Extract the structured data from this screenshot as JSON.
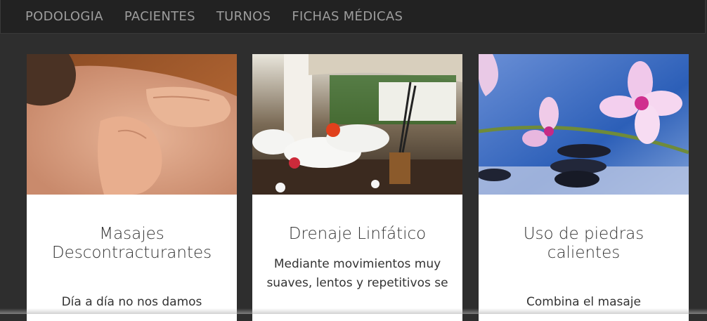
{
  "navbar": {
    "items": [
      {
        "label": "PODOLOGIA"
      },
      {
        "label": "PACIENTES"
      },
      {
        "label": "TURNOS"
      },
      {
        "label": "FICHAS MÉDICAS"
      }
    ],
    "background": "#222222",
    "link_color": "#9d9d9d"
  },
  "cards": [
    {
      "title": "Masajes Descontracturantes",
      "text": "Día a día no nos damos",
      "image": "back-massage-photo"
    },
    {
      "title": "Drenaje Linfático",
      "text": "Mediante movimientos muy suaves, lentos y repetitivos se",
      "image": "spa-towels-incense-photo"
    },
    {
      "title": "Uso de piedras calientes",
      "text": "Combina el masaje",
      "image": "orchid-hot-stones-photo"
    }
  ]
}
